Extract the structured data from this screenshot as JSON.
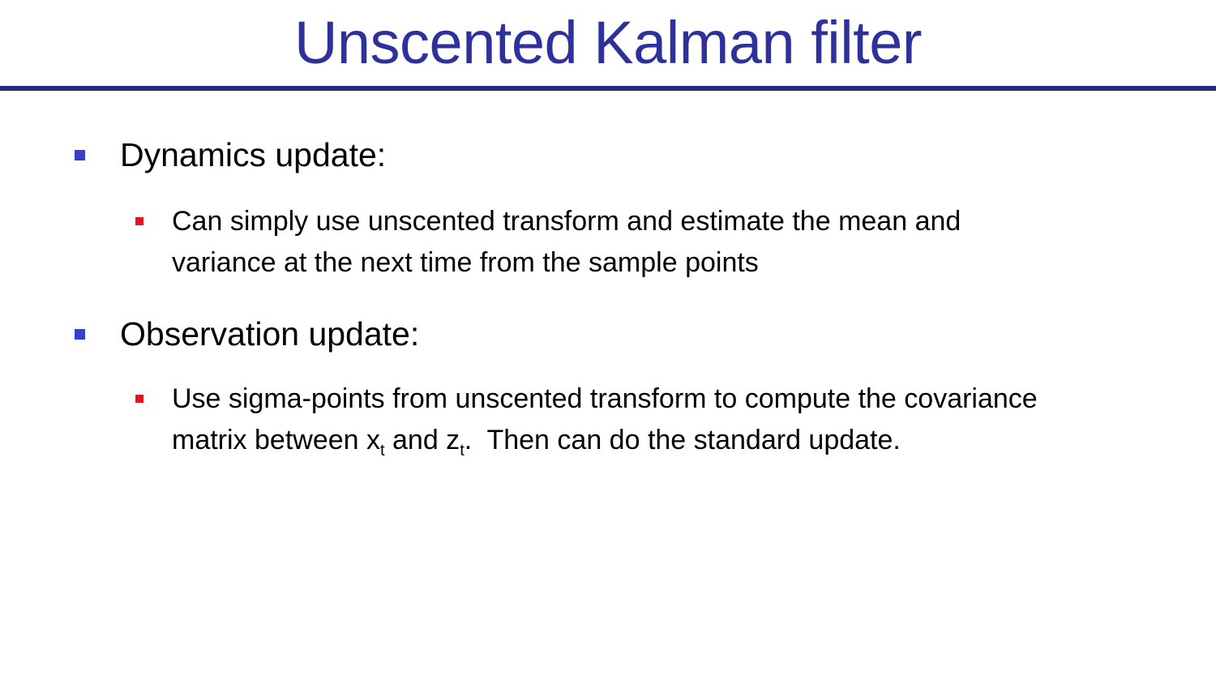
{
  "slide": {
    "title": "Unscented Kalman filter",
    "colors": {
      "title": "#2E309B",
      "rule": "#262A7E",
      "level1_bullet": "#3A3FC8",
      "level2_bullet": "#E8121A",
      "text": "#000000"
    },
    "bullets": [
      {
        "label": "Dynamics update:",
        "sub": {
          "line1": "Can simply use unscented transform and estimate the mean and",
          "line2": "variance at the next time from the sample points"
        }
      },
      {
        "label": "Observation update:",
        "sub": {
          "line1": "Use sigma-points from unscented transform to compute the covariance",
          "line2_part1": "matrix between x",
          "line2_sub1": "t",
          "line2_part2": " and z",
          "line2_sub2": "t",
          "line2_part3": ".  Then can do the standard update."
        }
      }
    ]
  }
}
